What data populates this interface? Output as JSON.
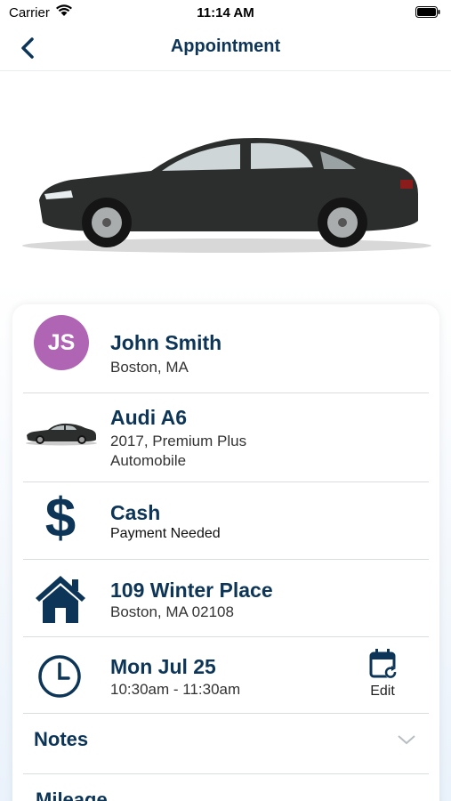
{
  "status_bar": {
    "carrier": "Carrier",
    "time": "11:14 AM"
  },
  "nav": {
    "title": "Appointment"
  },
  "customer": {
    "initials": "JS",
    "name": "John Smith",
    "location": "Boston, MA",
    "avatar_color": "#b064b4"
  },
  "vehicle": {
    "model": "Audi A6",
    "detail": "2017, Premium Plus",
    "type": "Automobile"
  },
  "payment": {
    "method": "Cash",
    "status": "Payment Needed"
  },
  "address": {
    "street": "109 Winter Place",
    "city": "Boston, MA 02108"
  },
  "schedule": {
    "date": "Mon Jul 25",
    "time_range": "10:30am - 11:30am",
    "edit_label": "Edit"
  },
  "sections": {
    "notes": "Notes",
    "mileage": "Mileage"
  },
  "colors": {
    "primary": "#0d3557",
    "divider": "#d9dde2"
  }
}
